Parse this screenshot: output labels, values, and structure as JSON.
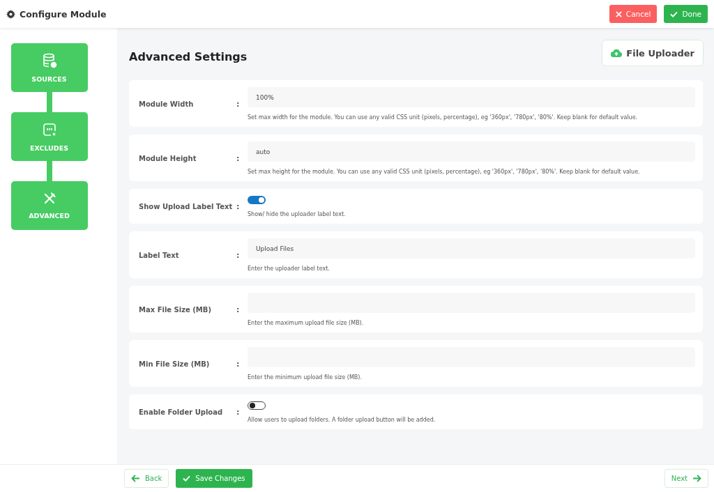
{
  "header": {
    "title": "Configure Module",
    "buttons": [
      {
        "label": "Cancel",
        "kind": "cancel"
      },
      {
        "label": "Done",
        "kind": "done"
      }
    ]
  },
  "steps": [
    {
      "label": "SOURCES",
      "kind": "database"
    },
    {
      "label": "EXCLUDES",
      "kind": "exclude"
    },
    {
      "label": "ADVANCED",
      "kind": "tools"
    }
  ],
  "section": {
    "title": "Advanced Settings",
    "module_badge": "File Uploader"
  },
  "settings": [
    {
      "label": "Module Width",
      "separator": ":",
      "kind": "text",
      "value": "100%",
      "help": "Set max width for the module. You can use any valid CSS unit (pixels, percentage), eg '360px', '780px', '80%'. Keep blank for default value."
    },
    {
      "label": "Module Height",
      "separator": ":",
      "kind": "text",
      "value": "auto",
      "help": "Set max height for the module. You can use any valid CSS unit (pixels, percentage), eg '360px', '780px', '80%'. Keep blank for default value."
    },
    {
      "label": "Show Upload Label Text",
      "separator": ":",
      "kind": "toggle",
      "on": true,
      "help": "Show/ hide the uploader label text."
    },
    {
      "label": "Label Text",
      "separator": ":",
      "kind": "text",
      "value": "Upload Files",
      "help": "Enter the uploader label text."
    },
    {
      "label": "Max File Size (MB)",
      "separator": ":",
      "kind": "text",
      "help": "Enter the maximum upload file size (MB)."
    },
    {
      "label": "Min File Size (MB)",
      "separator": ":",
      "kind": "text",
      "help": "Enter the minimum upload file size (MB)."
    },
    {
      "label": "Enable Folder Upload",
      "separator": ":",
      "kind": "toggle",
      "on": false,
      "help": "Allow users to upload folders. A folder upload button will be added."
    }
  ],
  "footer": {
    "back": "Back",
    "save": "Save Changes",
    "next": "Next"
  }
}
